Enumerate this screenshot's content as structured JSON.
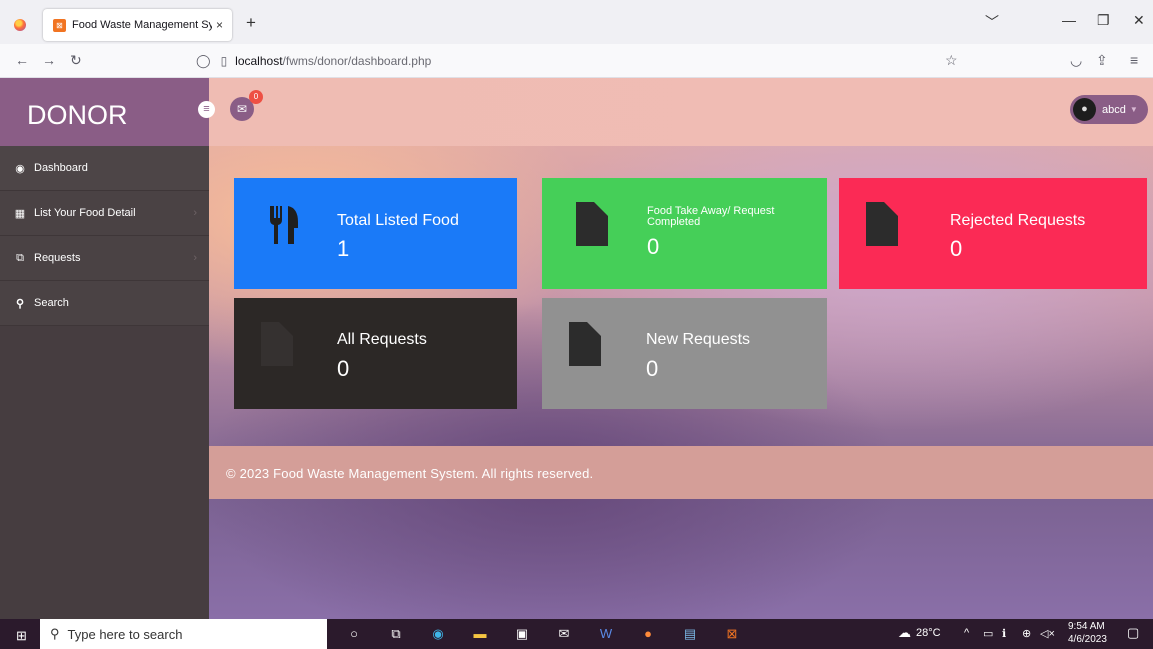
{
  "browser": {
    "tab_title": "Food Waste Management Syste",
    "tab_close": "×",
    "new_tab": "+",
    "url_host": "localhost",
    "url_path": "/fwms/donor/dashboard.php"
  },
  "sidebar": {
    "brand": "DONOR",
    "items": [
      {
        "label": "Dashboard",
        "icon": "dashboard-icon"
      },
      {
        "label": "List Your Food Detail",
        "icon": "table-icon"
      },
      {
        "label": "Requests",
        "icon": "copy-icon"
      },
      {
        "label": "Search",
        "icon": "search-icon"
      }
    ]
  },
  "topbar": {
    "mail_badge": "0",
    "username": "abcd"
  },
  "cards": [
    {
      "title": "Total Listed Food",
      "value": "1",
      "color": "#1a7af8",
      "icon": "cutlery-icon"
    },
    {
      "title": "Food Take Away/ Request Completed",
      "value": "0",
      "color": "#45cf58",
      "icon": "file-icon"
    },
    {
      "title": "Rejected Requests",
      "value": "0",
      "color": "#fb2a55",
      "icon": "file-icon"
    },
    {
      "title": "All Requests",
      "value": "0",
      "color": "#2c2826",
      "icon": "file-icon"
    },
    {
      "title": "New Requests",
      "value": "0",
      "color": "#919191",
      "icon": "file-icon"
    }
  ],
  "footer": "© 2023 Food Waste Management System. All rights reserved.",
  "taskbar": {
    "search_placeholder": "Type here to search",
    "weather": "28°C",
    "time": "9:54 AM",
    "date": "4/6/2023"
  }
}
